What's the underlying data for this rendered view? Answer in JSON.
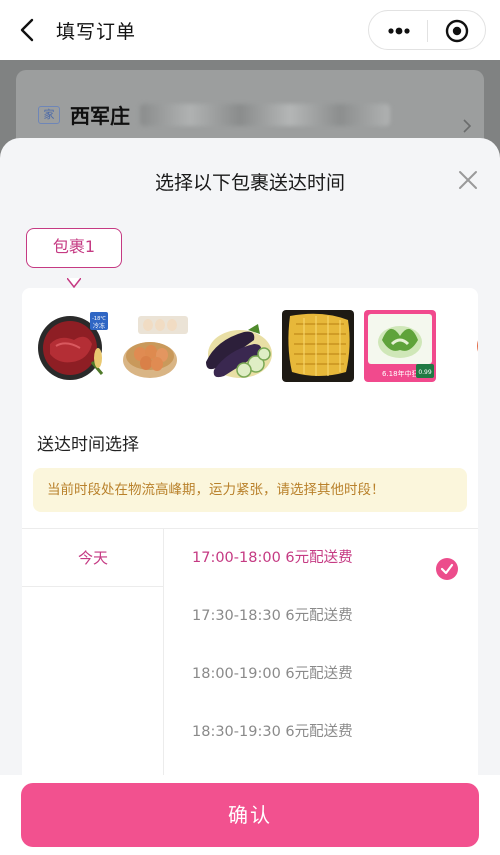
{
  "navbar": {
    "title": "填写订单",
    "icons": [
      "back-arrow-icon",
      "more-dots-icon",
      "target-icon"
    ]
  },
  "background": {
    "address_tag": "家",
    "address_text": "西军庄"
  },
  "sheet": {
    "title": "选择以下包裹送达时间",
    "package_tab": "包裹1",
    "thumbnails": [
      {
        "name": "beef",
        "badge_top": "-18℃",
        "badge_bottom": "冷冻"
      },
      {
        "name": "eggs"
      },
      {
        "name": "eggplant"
      },
      {
        "name": "corn"
      },
      {
        "name": "bok-choy",
        "promo_text": "6.18年中狂欢",
        "price": "0.99"
      },
      {
        "name": "partial-item"
      }
    ],
    "section_title": "送达时间选择",
    "warning": "当前时段处在物流高峰期，运力紧张，请选择其他时段！",
    "days": [
      {
        "label": "今天"
      }
    ],
    "slots": [
      {
        "label": "17:00-18:00 6元配送费",
        "selected": true
      },
      {
        "label": "17:30-18:30 6元配送费",
        "selected": false
      },
      {
        "label": "18:00-19:00 6元配送费",
        "selected": false
      },
      {
        "label": "18:30-19:30 6元配送费",
        "selected": false
      }
    ],
    "confirm_label": "确认"
  },
  "colors": {
    "accent": "#c53a83",
    "button": "#f2518f",
    "warning_bg": "#fbf6dc",
    "warning_text": "#b9812b"
  }
}
